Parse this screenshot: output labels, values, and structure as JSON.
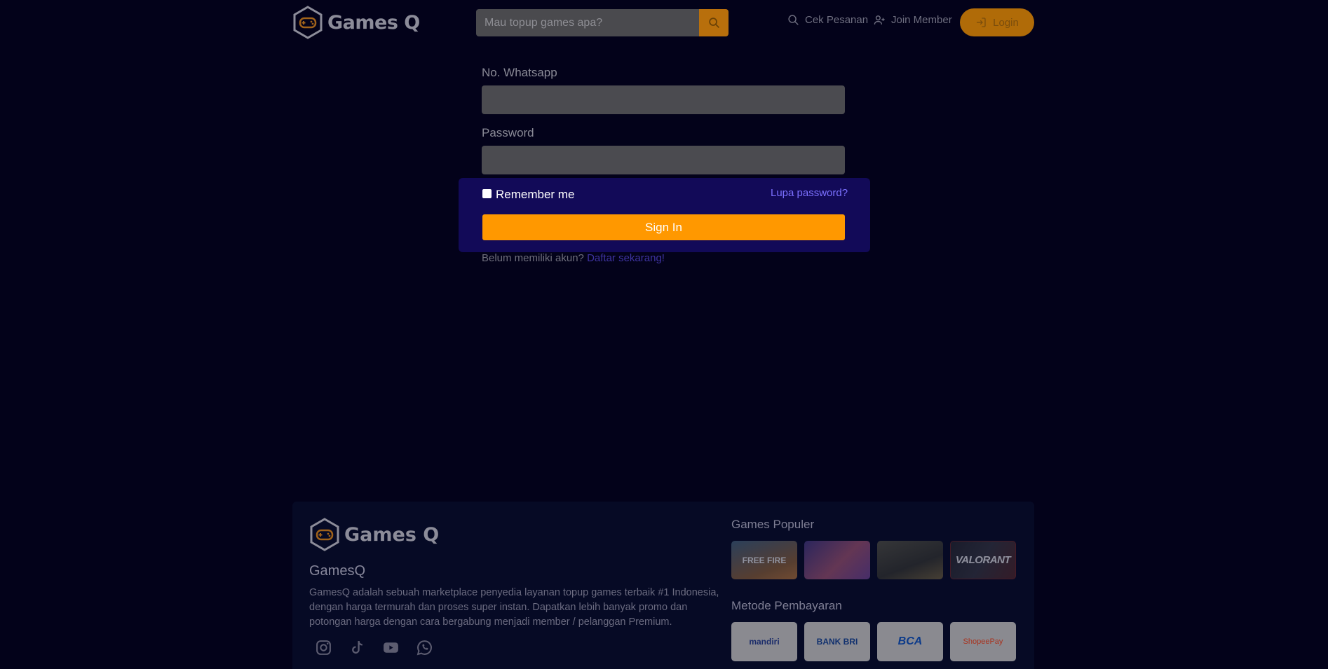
{
  "brand": {
    "name": "Games Q"
  },
  "header": {
    "search_placeholder": "Mau topup games apa?",
    "nav": {
      "check_order": "Cek Pesanan",
      "join_member": "Join Member",
      "login": "Login"
    }
  },
  "form": {
    "whatsapp_label": "No. Whatsapp",
    "password_label": "Password",
    "remember_label": "Remember me",
    "forgot_label": "Lupa password?",
    "signin_label": "Sign In",
    "register_prompt": "Belum memiliki akun?",
    "register_link": "Daftar sekarang!"
  },
  "footer": {
    "logo_text": "Games Q",
    "name": "GamesQ",
    "description": "GamesQ adalah sebuah marketplace penyedia layanan topup games terbaik #1 Indonesia, dengan harga termurah dan proses super instan. Dapatkan lebih banyak promo dan potongan harga dengan cara bergabung menjadi member / pelanggan Premium.",
    "social_icons": [
      "instagram-icon",
      "tiktok-icon",
      "youtube-icon",
      "whatsapp-icon"
    ],
    "popular_title": "Games Populer",
    "popular_games": [
      "FREE FIRE",
      "",
      "",
      "VALORANT"
    ],
    "payment_title": "Metode Pembayaran",
    "payment_methods": [
      "mandiri",
      "BANK BRI",
      "BCA",
      "ShopeePay"
    ]
  },
  "colors": {
    "background": "#03021a",
    "accent": "#ff9800",
    "panel": "#120a58",
    "link": "#7b70ff"
  }
}
